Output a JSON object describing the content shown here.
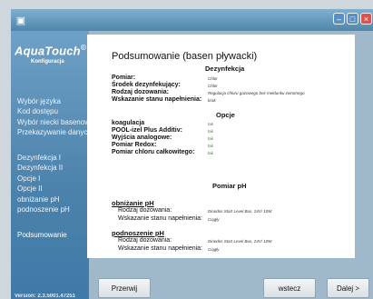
{
  "window": {
    "app_icon": "app-icon"
  },
  "sidebar": {
    "logo": "AquaTouch",
    "logo_sub": "Konfiguracja",
    "items": [
      "Wybór języka",
      "Kod dostępu",
      "Wybór niecki basenowej",
      "Przekazywanie danych:",
      "Dezynfekcja I",
      "Dezynfekcja II",
      "Opcje I",
      "Opcje II",
      "obniżanie pH",
      "podnoszenie pH",
      "Podsumowanie"
    ],
    "version": "Version: 2.3.5001.47251"
  },
  "summary": {
    "title": "Podsumowanie (basen pływacki)",
    "dezynfekcja": {
      "heading": "Dezynfekcja",
      "rows": [
        {
          "label": "Pomiar:",
          "value": "Chlor"
        },
        {
          "label": "Środek dezynfekujący:",
          "value": "Chlor"
        },
        {
          "label": "Rodzaj dozowania:",
          "value": "Regulacja chloru gazowego bez meldunku zwrotnego"
        },
        {
          "label": "Wskazanie stanu napełnienia:",
          "value": "brak"
        }
      ]
    },
    "opcje": {
      "heading": "Opcje",
      "rows": [
        {
          "label": "koagulacja",
          "value": "tak"
        },
        {
          "label": "POOL-izel Plus Additiv:",
          "value": "tak"
        },
        {
          "label": "Wyjścia analogowe:",
          "value": "tak"
        },
        {
          "label": "Pomiar Redox:",
          "value": "tak"
        },
        {
          "label": "Pomiar chloru całkowitego:",
          "value": "tak"
        }
      ]
    },
    "ph": {
      "heading": "Pomiar pH",
      "obnizanie": {
        "heading": "obniżanie pH",
        "rows": [
          {
            "label": "Rodzaj dozowania:",
            "value": "Dinodos Start Level Bus, 24V/ 10W"
          },
          {
            "label": "Wskazanie stanu napełnienia:",
            "value": "Ciągły"
          }
        ]
      },
      "podnoszenie": {
        "heading": "podnoszenie pH",
        "rows": [
          {
            "label": "Rodzaj dozowania:",
            "value": "Dinodos Start Level Bus, 24V/ 10W"
          },
          {
            "label": "Wskazanie stanu napełnienia:",
            "value": "Ciągły"
          }
        ]
      }
    }
  },
  "buttons": {
    "cancel": "Przerwij",
    "back": "wstecz",
    "next": "Dalej >"
  }
}
